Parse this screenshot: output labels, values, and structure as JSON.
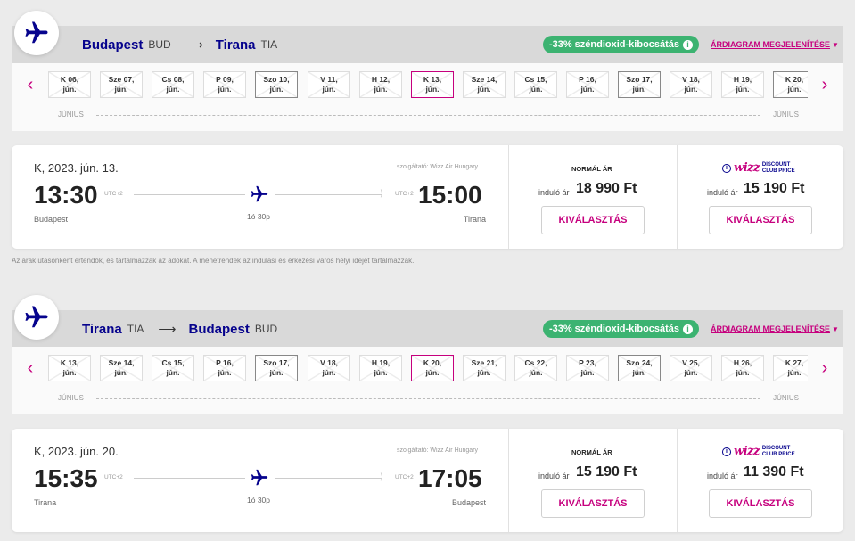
{
  "common": {
    "co2_text": "-33% széndioxid-kibocsátás",
    "info_glyph": "i",
    "diagram_link": "ÁRDIAGRAM MEGJELENÍTÉSE",
    "month_label": "JÚNIUS",
    "operator": "szolgáltató: Wizz Air Hungary",
    "normal_price_title": "NORMÁL ÁR",
    "from_label": "induló ár",
    "select_label": "KIVÁLASZTÁS",
    "select_label_wdc": "KIVÁLASZTÁS",
    "wizz_logo_text": "wizz",
    "wdc_line1": "DISCOUNT",
    "wdc_line2": "CLUB PRICE",
    "disclaimer": "Az árak utasonként értendők, és tartalmazzák az adókat. A menetrendek az indulási és érkezési város helyi idejét tartalmazzák.",
    "icons": [
      "airplane-icon",
      "chevron-left-icon",
      "chevron-right-icon",
      "info-icon",
      "caret-down-icon"
    ],
    "colors": {
      "brand_navy": "#06038d",
      "brand_magenta": "#c6007e",
      "co2_green": "#3cb371"
    }
  },
  "outbound": {
    "origin_city": "Budapest",
    "origin_code": "BUD",
    "dest_city": "Tirana",
    "dest_code": "TIA",
    "dates": [
      {
        "l1": "K 06,",
        "l2": "jún.",
        "style": "plain"
      },
      {
        "l1": "Sze 07,",
        "l2": "jún.",
        "style": "plain"
      },
      {
        "l1": "Cs 08,",
        "l2": "jún.",
        "style": "plain"
      },
      {
        "l1": "P 09,",
        "l2": "jún.",
        "style": "plain"
      },
      {
        "l1": "Szo 10,",
        "l2": "jún.",
        "style": "boxed"
      },
      {
        "l1": "V 11,",
        "l2": "jún.",
        "style": "plain"
      },
      {
        "l1": "H 12,",
        "l2": "jún.",
        "style": "plain"
      },
      {
        "l1": "K 13,",
        "l2": "jún.",
        "style": "selected"
      },
      {
        "l1": "Sze 14,",
        "l2": "jún.",
        "style": "plain"
      },
      {
        "l1": "Cs 15,",
        "l2": "jún.",
        "style": "plain"
      },
      {
        "l1": "P 16,",
        "l2": "jún.",
        "style": "plain"
      },
      {
        "l1": "Szo 17,",
        "l2": "jún.",
        "style": "boxed"
      },
      {
        "l1": "V 18,",
        "l2": "jún.",
        "style": "plain"
      },
      {
        "l1": "H 19,",
        "l2": "jún.",
        "style": "plain"
      },
      {
        "l1": "K 20,",
        "l2": "jún.",
        "style": "boxed"
      }
    ],
    "flight": {
      "date": "K, 2023. jún. 13.",
      "dep_time": "13:30",
      "arr_time": "15:00",
      "dep_utc": "UTC+2",
      "arr_utc": "UTC+2",
      "duration": "1ó 30p",
      "dep_city": "Budapest",
      "arr_city": "Tirana",
      "normal_price": "18 990 Ft",
      "wdc_price": "15 190 Ft"
    }
  },
  "inbound": {
    "origin_city": "Tirana",
    "origin_code": "TIA",
    "dest_city": "Budapest",
    "dest_code": "BUD",
    "dates": [
      {
        "l1": "K 13,",
        "l2": "jún.",
        "style": "plain"
      },
      {
        "l1": "Sze 14,",
        "l2": "jún.",
        "style": "plain"
      },
      {
        "l1": "Cs 15,",
        "l2": "jún.",
        "style": "plain"
      },
      {
        "l1": "P 16,",
        "l2": "jún.",
        "style": "plain"
      },
      {
        "l1": "Szo 17,",
        "l2": "jún.",
        "style": "boxed"
      },
      {
        "l1": "V 18,",
        "l2": "jún.",
        "style": "plain"
      },
      {
        "l1": "H 19,",
        "l2": "jún.",
        "style": "plain"
      },
      {
        "l1": "K 20,",
        "l2": "jún.",
        "style": "selected"
      },
      {
        "l1": "Sze 21,",
        "l2": "jún.",
        "style": "plain"
      },
      {
        "l1": "Cs 22,",
        "l2": "jún.",
        "style": "plain"
      },
      {
        "l1": "P 23,",
        "l2": "jún.",
        "style": "plain"
      },
      {
        "l1": "Szo 24,",
        "l2": "jún.",
        "style": "boxed"
      },
      {
        "l1": "V 25,",
        "l2": "jún.",
        "style": "plain"
      },
      {
        "l1": "H 26,",
        "l2": "jún.",
        "style": "plain"
      },
      {
        "l1": "K 27,",
        "l2": "jún.",
        "style": "plain"
      }
    ],
    "flight": {
      "date": "K, 2023. jún. 20.",
      "dep_time": "15:35",
      "arr_time": "17:05",
      "dep_utc": "UTC+2",
      "arr_utc": "UTC+2",
      "duration": "1ó 30p",
      "dep_city": "Tirana",
      "arr_city": "Budapest",
      "normal_price": "15 190 Ft",
      "wdc_price": "11 390 Ft"
    }
  }
}
